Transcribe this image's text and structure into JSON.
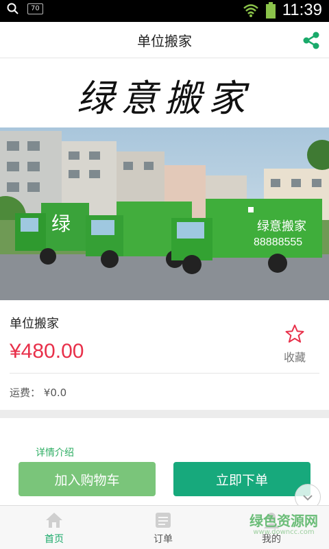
{
  "status_bar": {
    "badge": "70",
    "time": "11:39"
  },
  "header": {
    "title": "单位搬家"
  },
  "banner": {
    "calligraphy": "绿意搬家"
  },
  "photo": {
    "truck_text": "绿意搬家",
    "truck_phone": "88888555",
    "truck_brand": "绿"
  },
  "product": {
    "name": "单位搬家",
    "price": "¥480.00",
    "favorite_label": "收藏",
    "shipping_label": "运费：",
    "shipping_value": "¥0.0"
  },
  "details": {
    "title": "详情介绍"
  },
  "actions": {
    "add_to_cart": "加入购物车",
    "buy_now": "立即下单"
  },
  "tabbar": {
    "items": [
      {
        "label": "首页"
      },
      {
        "label": "订单"
      },
      {
        "label": "我的"
      }
    ]
  },
  "watermark": {
    "main": "绿色资源网",
    "sub": "www.downcc.com"
  },
  "colors": {
    "accent": "#17a97c",
    "price": "#e8304a",
    "cart_button": "#7ac57a"
  }
}
